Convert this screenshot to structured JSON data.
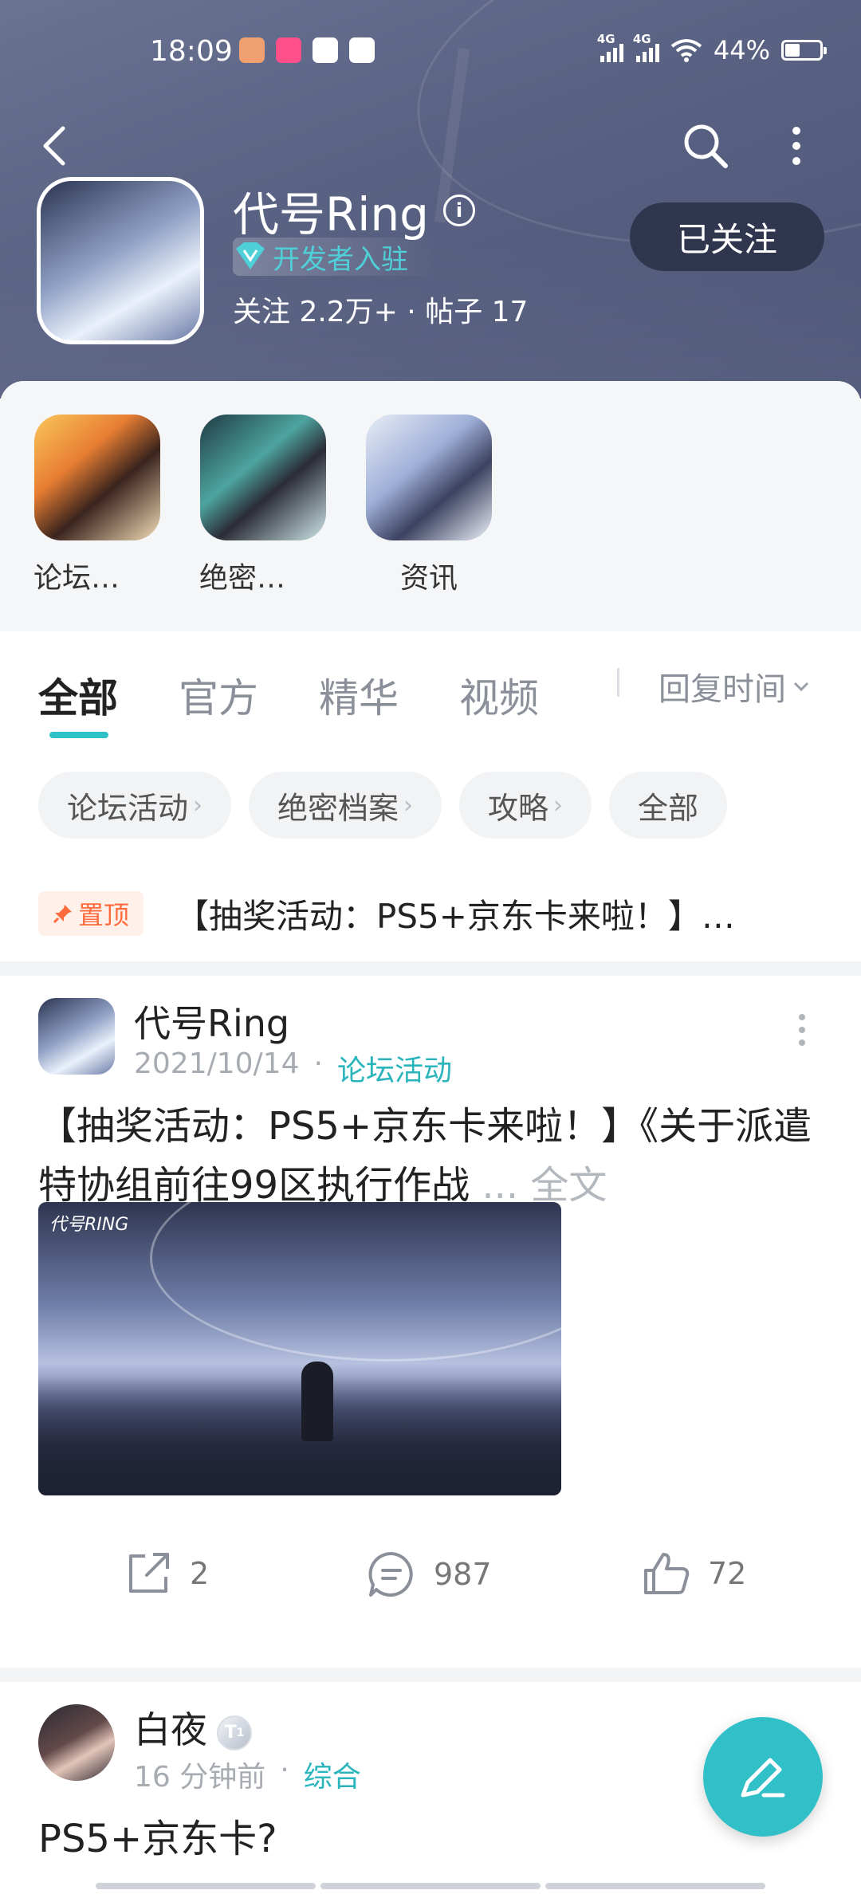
{
  "status_bar": {
    "time": "18:09",
    "network1": "4G",
    "network2": "4G",
    "battery": "44%",
    "battery_level": 0.44
  },
  "header": {
    "forum_name": "代号Ring",
    "dev_badge": "开发者入驻",
    "stats": "关注 2.2万+ · 帖子 17",
    "follow_label": "已关注"
  },
  "sub_forums": [
    {
      "label": "论坛…"
    },
    {
      "label": "绝密…"
    },
    {
      "label": "资讯"
    }
  ],
  "tabs": [
    {
      "label": "全部",
      "active": true
    },
    {
      "label": "官方"
    },
    {
      "label": "精华"
    },
    {
      "label": "视频"
    }
  ],
  "sort_label": "回复时间",
  "chips": [
    {
      "label": "论坛活动",
      "arrow": "›"
    },
    {
      "label": "绝密档案",
      "arrow": "›"
    },
    {
      "label": "攻略",
      "arrow": "›"
    },
    {
      "label": "全部"
    }
  ],
  "pinned": {
    "tag": "置顶",
    "text": "【抽奖活动：PS5+京东卡来啦！】…"
  },
  "posts": [
    {
      "author": "代号Ring",
      "date": "2021/10/14",
      "category": "论坛活动",
      "title": "【抽奖活动：PS5+京东卡来啦！】《关于派遣特协组前往99区执行作战",
      "ellipsis": "...",
      "fulltext": "全文",
      "image_logo": "代号RING",
      "shares": "2",
      "comments": "987",
      "likes": "72"
    },
    {
      "author": "白夜",
      "level": "1",
      "time": "16 分钟前",
      "category": "综合",
      "title": "PS5+京东卡?"
    }
  ],
  "colors": {
    "accent": "#31c0c8",
    "header_bg": "#5b6384",
    "pin": "#ff6b3d"
  }
}
